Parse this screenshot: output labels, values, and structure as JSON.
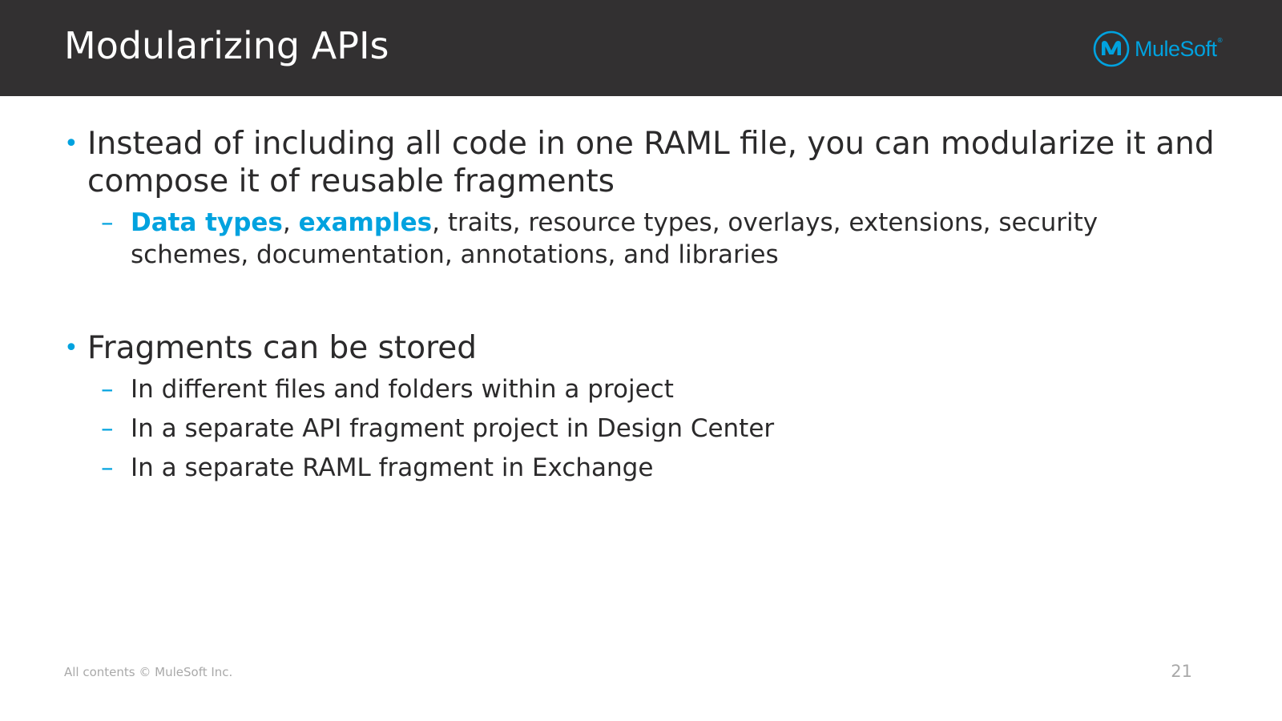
{
  "slide": {
    "title": "Modularizing APIs",
    "logo_text": "MuleSoft",
    "logo_mark": "®",
    "footer": "All contents © MuleSoft Inc.",
    "page_number": "21"
  },
  "bullets": [
    {
      "text": "Instead of including all code in one RAML file, you can modularize it and compose it of reusable fragments",
      "sub": {
        "highlight1": "Data types",
        "sep": ", ",
        "highlight2": "examples",
        "rest": ", traits, resource types, overlays, extensions, security schemes, documentation, annotations, and libraries"
      }
    },
    {
      "text": "Fragments can be stored",
      "subs": [
        "In different files and folders within a project",
        "In a separate API fragment project in Design Center",
        "In a separate RAML fragment in Exchange"
      ]
    }
  ],
  "colors": {
    "accent": "#00a2df",
    "header_bg": "#323031",
    "text": "#2b2a2b",
    "footer_text": "#a9a9a9"
  },
  "icons": {
    "logo": "mulesoft-logo-icon"
  }
}
